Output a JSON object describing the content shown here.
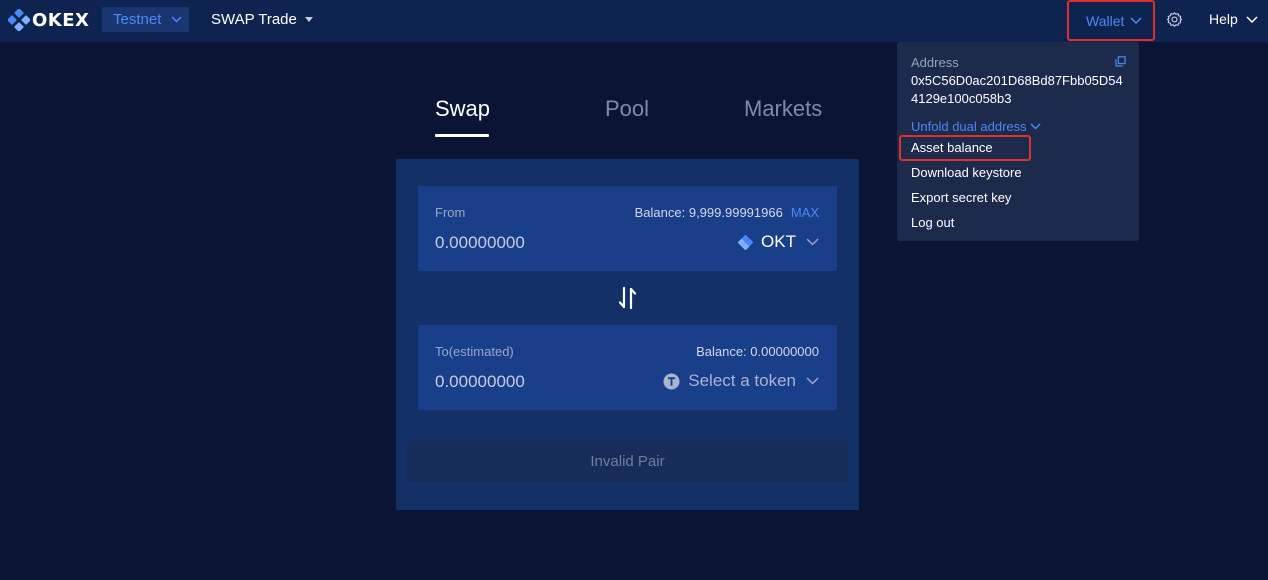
{
  "header": {
    "brand": "OKEX",
    "network": "Testnet",
    "nav_label": "SWAP Trade",
    "wallet_label": "Wallet",
    "help_label": "Help"
  },
  "tabs": [
    {
      "label": "Swap",
      "active": true
    },
    {
      "label": "Pool",
      "active": false
    },
    {
      "label": "Markets",
      "active": false
    }
  ],
  "swap": {
    "from": {
      "label": "From",
      "balance": "Balance: 9,999.99991966",
      "max_label": "MAX",
      "amount": "0.00000000",
      "token": "OKT",
      "token_icon": "okt-logo-icon"
    },
    "to": {
      "label": "To(estimated)",
      "balance": "Balance: 0.00000000",
      "amount": "0.00000000",
      "token": "Select a token",
      "token_icon": "token-placeholder-icon"
    },
    "action_label": "Invalid Pair"
  },
  "wallet_menu": {
    "address_label": "Address",
    "address": "0x5C56D0ac201D68Bd87Fbb05D544129e100c058b3",
    "unfold_label": "Unfold dual address",
    "items": [
      "Asset balance",
      "Download keystore",
      "Export secret key",
      "Log out"
    ]
  },
  "colors": {
    "background": "#0a1535",
    "header": "#0f2350",
    "accent": "#4b88f7",
    "card": "#133166",
    "highlight": "#e0302a"
  }
}
